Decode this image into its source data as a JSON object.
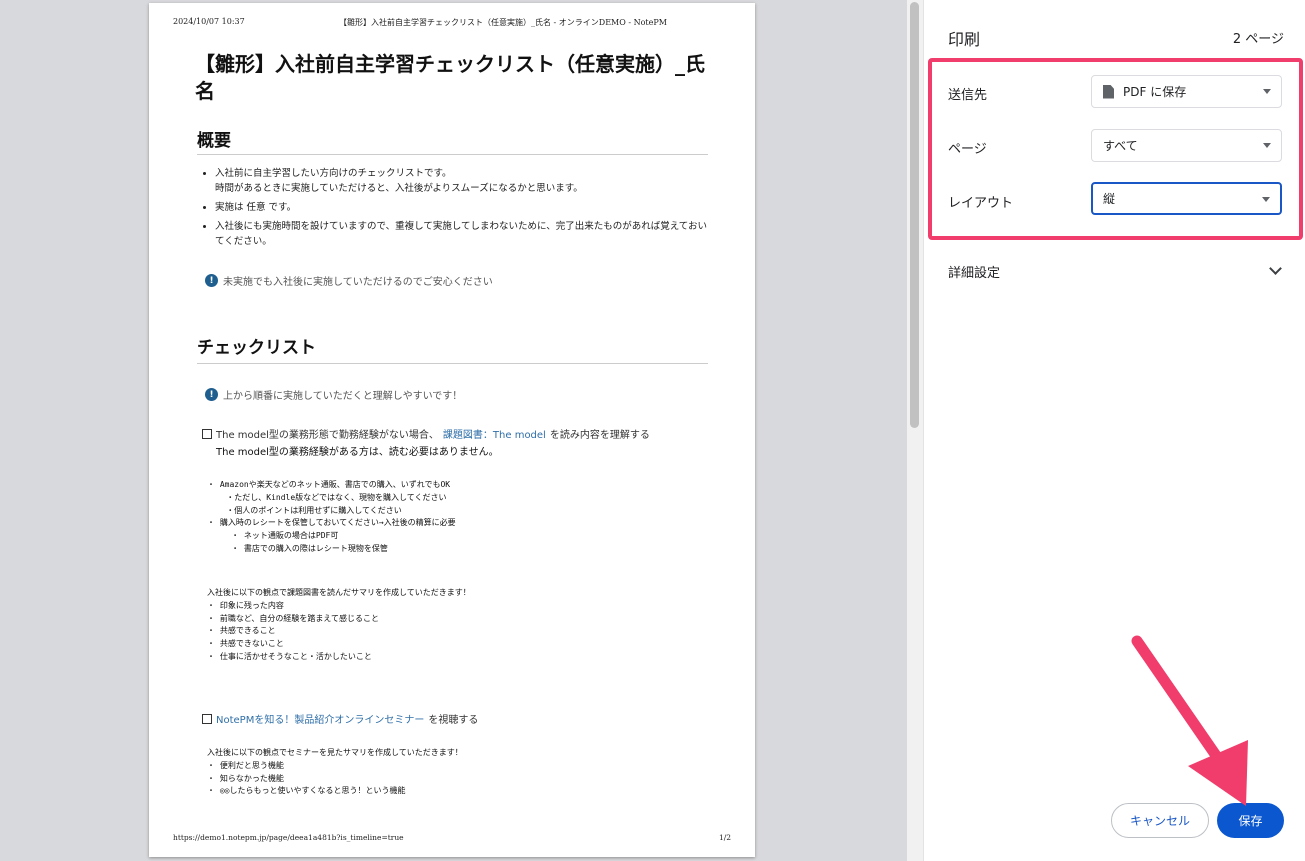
{
  "preview": {
    "header_date": "2024/10/07 10:37",
    "header_title": "【雛形】入社前自主学習チェックリスト（任意実施）_氏名 - オンラインDEMO - NotePM",
    "doc_title": "【雛形】入社前自主学習チェックリスト（任意実施）_氏名",
    "section1": "概要",
    "bullets": [
      "入社前に自主学習したい方向けのチェックリストです。",
      "時間があるときに実施していただけると、入社後がよりスムーズになるかと思います。",
      "実施は 任意 です。",
      "入社後にも実施時間を設けていますので、重複して実施してしまわないために、完了出来たものがあれば覚えておいてください。"
    ],
    "note1": "未実施でも入社後に実施していただけるのでご安心ください",
    "section2": "チェックリスト",
    "note2": "上から順番に実施していただくと理解しやすいです！",
    "check1_pre": "The model型の業務形態で勤務経験がない場合、",
    "check1_link": "課題図書：The model",
    "check1_post": " を読み内容を理解する",
    "check1_sub": "The model型の業務経験がある方は、読む必要はありません。",
    "block1": "・ Amazonや楽天などのネット通販、書店での購入、いずれでもOK\n    ・ただし、Kindle版などではなく、現物を購入してください\n    ・個人のポイントは利用せずに購入してください\n・ 購入時のレシートを保管しておいてください→入社後の精算に必要\n     ・ ネット通販の場合はPDF可\n     ・ 書店での購入の際はレシート現物を保管",
    "block2": "入社後に以下の観点で課題図書を読んだサマリを作成していただきます！\n・ 印象に残った内容\n・ 前職など、自分の経験を踏まえて感じること\n・ 共感できること\n・ 共感できないこと\n・ 仕事に活かせそうなこと・活かしたいこと",
    "check2_link": "NotePMを知る！製品紹介オンラインセミナー",
    "check2_post": "を視聴する",
    "block3": "入社後に以下の観点でセミナーを見たサマリを作成していただきます！\n・ 便利だと思う機能\n・ 知らなかった機能\n・ ◎◎したらもっと使いやすくなると思う！という機能",
    "footer_url": "https://demo1.notepm.jp/page/deea1a481b?is_timeline=true",
    "footer_page": "1/2"
  },
  "panel": {
    "title": "印刷",
    "page_count": "2 ページ",
    "destination_label": "送信先",
    "destination_value": "PDF に保存",
    "pages_label": "ページ",
    "pages_value": "すべて",
    "layout_label": "レイアウト",
    "layout_value": "縦",
    "more_settings": "詳細設定",
    "cancel": "キャンセル",
    "save": "保存"
  },
  "colors": {
    "highlight": "#f03d6c",
    "primary": "#0b57d0"
  }
}
